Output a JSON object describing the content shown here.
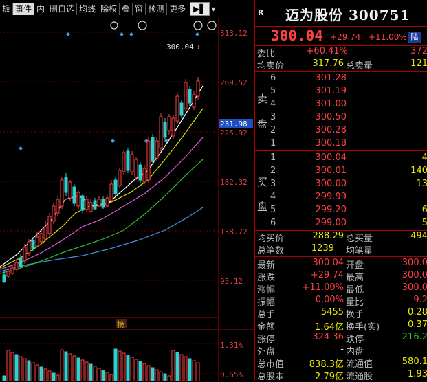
{
  "toolbar": {
    "items": [
      "板",
      "事件",
      "内",
      "删自选",
      "均线",
      "除权",
      "叠",
      "窗",
      "预测",
      "更多"
    ],
    "arrow": "▶▌"
  },
  "chart": {
    "price_axis": [
      "313.12",
      "269.52",
      "225.92",
      "182.32",
      "138.72",
      "95.12"
    ],
    "current_tag": "231.98",
    "price_note": "300.04",
    "bottom_label": "榜",
    "vol_axis": [
      "1.31%",
      "0.65%"
    ]
  },
  "stock": {
    "badge": "R",
    "title": "迈为股份 300751",
    "price": "300.04",
    "change": "+29.74",
    "change_pct": "+11.00%",
    "board": "陆"
  },
  "quote": {
    "weibi_label": "委比",
    "weibi_value": "+60.41%",
    "weibi_extra": "372",
    "avg_sell_label": "均卖价",
    "avg_sell_value": "317.76",
    "total_sell_label": "总卖量",
    "total_sell_value": "121",
    "sell_label_1": "卖",
    "sell_label_2": "盘",
    "sell": [
      {
        "lvl": "6",
        "price": "301.28"
      },
      {
        "lvl": "5",
        "price": "301.19"
      },
      {
        "lvl": "4",
        "price": "301.00"
      },
      {
        "lvl": "3",
        "price": "300.50"
      },
      {
        "lvl": "2",
        "price": "300.28"
      },
      {
        "lvl": "1",
        "price": "300.18"
      }
    ],
    "buy_label_1": "买",
    "buy_label_2": "盘",
    "buy": [
      {
        "lvl": "1",
        "price": "300.04",
        "vol": "4"
      },
      {
        "lvl": "2",
        "price": "300.01",
        "vol": "140"
      },
      {
        "lvl": "3",
        "price": "300.00",
        "vol": "13"
      },
      {
        "lvl": "4",
        "price": "299.99",
        "vol": ""
      },
      {
        "lvl": "5",
        "price": "299.20",
        "vol": "6"
      },
      {
        "lvl": "6",
        "price": "299.00",
        "vol": "5"
      }
    ],
    "avg_buy_label": "均买价",
    "avg_buy_value": "288.29",
    "total_buy_label": "总买量",
    "total_buy_value": "494",
    "deals_label": "总笔数",
    "deals_value": "1239",
    "avg_vol_label": "均笔量",
    "stats": [
      {
        "l1": "最新",
        "v1": "300.04",
        "c1": "red",
        "l2": "开盘",
        "v2": "300.0",
        "c2": "red"
      },
      {
        "l1": "涨跌",
        "v1": "+29.74",
        "c1": "red",
        "l2": "最高",
        "v2": "300.0",
        "c2": "red"
      },
      {
        "l1": "涨幅",
        "v1": "+11.00%",
        "c1": "red",
        "l2": "最低",
        "v2": "300.0",
        "c2": "red"
      },
      {
        "l1": "振幅",
        "v1": "0.00%",
        "c1": "red",
        "l2": "量比",
        "v2": "9.2",
        "c2": "red"
      },
      {
        "l1": "总手",
        "v1": "5455",
        "c1": "yellow",
        "l2": "换手",
        "v2": "0.28",
        "c2": "yellow"
      },
      {
        "l1": "金额",
        "v1": "1.64亿",
        "c1": "yellow",
        "l2": "换手(实)",
        "v2": "0.37",
        "c2": "yellow"
      },
      {
        "l1": "涨停",
        "v1": "324.36",
        "c1": "red",
        "l2": "跌停",
        "v2": "216.2",
        "c2": "green"
      },
      {
        "l1": "外盘",
        "v1": "-",
        "c1": "white",
        "l2": "内盘",
        "v2": "",
        "c2": "white"
      },
      {
        "l1": "总市值",
        "v1": "838.3亿",
        "c1": "yellow",
        "l2": "流通值",
        "v2": "580.1",
        "c2": "yellow"
      },
      {
        "l1": "总股本",
        "v1": "2.79亿",
        "c1": "yellow",
        "l2": "流通股",
        "v2": "1.93",
        "c2": "yellow"
      }
    ]
  },
  "colors": {
    "up": "#ff4040",
    "down": "#30d0d0",
    "accent": "#a00000"
  }
}
